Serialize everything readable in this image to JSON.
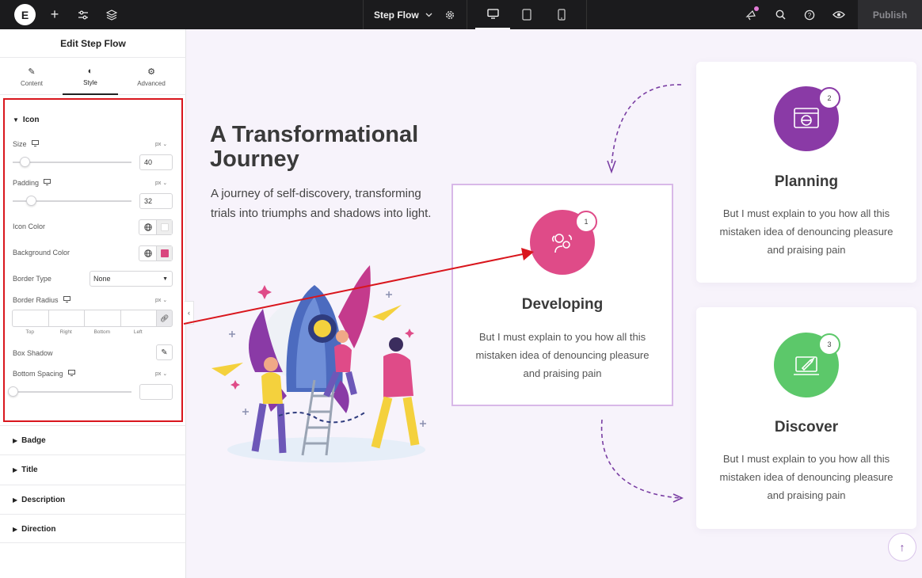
{
  "topbar": {
    "logo_letter": "E",
    "page_name": "Step Flow",
    "publish_label": "Publish",
    "icons": [
      "add-icon",
      "settings-sliders-icon",
      "layers-icon",
      "gear-icon",
      "desktop-icon",
      "tablet-icon",
      "mobile-icon",
      "notifications-icon",
      "search-icon",
      "help-icon",
      "preview-eye-icon"
    ]
  },
  "sidebar": {
    "title": "Edit Step Flow",
    "tabs": [
      {
        "label": "Content",
        "icon": "pencil-icon"
      },
      {
        "label": "Style",
        "icon": "contrast-icon"
      },
      {
        "label": "Advanced",
        "icon": "gear-icon"
      }
    ],
    "icon_section": {
      "heading": "Icon",
      "size": {
        "label": "Size",
        "unit": "px",
        "value": "40",
        "slider_fraction": 0.1
      },
      "padding": {
        "label": "Padding",
        "unit": "px",
        "value": "32",
        "slider_fraction": 0.15
      },
      "icon_color": {
        "label": "Icon Color",
        "swatch": "#ffffff"
      },
      "background_color": {
        "label": "Background Color",
        "swatch": "#d9467e"
      },
      "border_type": {
        "label": "Border Type",
        "value": "None"
      },
      "border_radius": {
        "label": "Border Radius",
        "unit": "px",
        "sides": [
          "Top",
          "Right",
          "Bottom",
          "Left"
        ]
      },
      "box_shadow": {
        "label": "Box Shadow"
      },
      "bottom_spacing": {
        "label": "Bottom Spacing",
        "unit": "px",
        "value": "",
        "slider_fraction": 0
      }
    },
    "collapsed_sections": [
      "Badge",
      "Title",
      "Description",
      "Direction"
    ]
  },
  "canvas": {
    "hero_title": "A Transformational Journey",
    "hero_subtitle": "A journey of self-discovery, transforming trials into triumphs and shadows into light.",
    "cards": [
      {
        "number": "1",
        "title": "Developing",
        "description": "But I must explain to you how all this mistaken idea of denouncing pleasure and praising pain",
        "color": "#df4b88",
        "icon": "mind-gears-icon"
      },
      {
        "number": "2",
        "title": "Planning",
        "description": "But I must explain to you how all this mistaken idea of denouncing pleasure and praising pain",
        "color": "#8a3aa6",
        "icon": "browser-globe-icon"
      },
      {
        "number": "3",
        "title": "Discover",
        "description": "But I must explain to you how all this mistaken idea of denouncing pleasure and praising pain",
        "color": "#5cc86a",
        "icon": "rocket-laptop-icon"
      }
    ],
    "accent_arrow_color": "#7a3ea3",
    "annotation_arrow_color": "#d9161d"
  }
}
